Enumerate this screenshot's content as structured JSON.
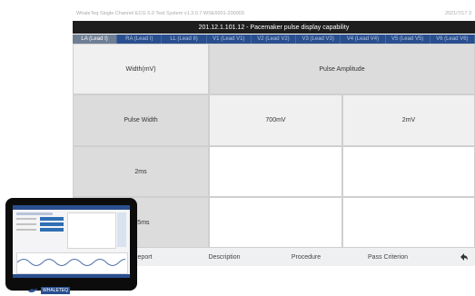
{
  "window": {
    "title_left": "WhaleTeq Single Channel ECG 5.0 Test System v1.3.0.7 WSE6001-200003",
    "date": "2021/7/17 3"
  },
  "header": {
    "title": "201.12.1.101.12 - Pacemaker pulse display capability"
  },
  "tabs": [
    {
      "label": "LA (Lead I)"
    },
    {
      "label": "RA (Lead I)"
    },
    {
      "label": "LL (Lead II)"
    },
    {
      "label": "V1 (Lead V1)"
    },
    {
      "label": "V2 (Lead V2)"
    },
    {
      "label": "V3 (Lead V3)"
    },
    {
      "label": "V4 (Lead V4)"
    },
    {
      "label": "V5 (Lead V5)"
    },
    {
      "label": "V6 (Lead V6)"
    }
  ],
  "table": {
    "corner_label": "Width(mV)",
    "span_header": "Pulse Amplitude",
    "row_header": "Pulse Width",
    "col_headers": [
      "700mV",
      "2mV"
    ],
    "rows": [
      {
        "label": "2ms",
        "cells": [
          "",
          ""
        ]
      },
      {
        "label": "0.5ms",
        "cells": [
          "",
          ""
        ]
      }
    ]
  },
  "bottom_nav": {
    "report": "Report",
    "description": "Description",
    "procedure": "Procedure",
    "pass_criterion": "Pass Criterion",
    "back_icon": "back-arrow-icon"
  },
  "device": {
    "brand": "WHALETEQ"
  },
  "colors": {
    "titlebar": "#1e1e1e",
    "tabbar": "#2a4f8f",
    "active_tab": "#6e7e93",
    "header_gray": "#dcdcdc"
  }
}
